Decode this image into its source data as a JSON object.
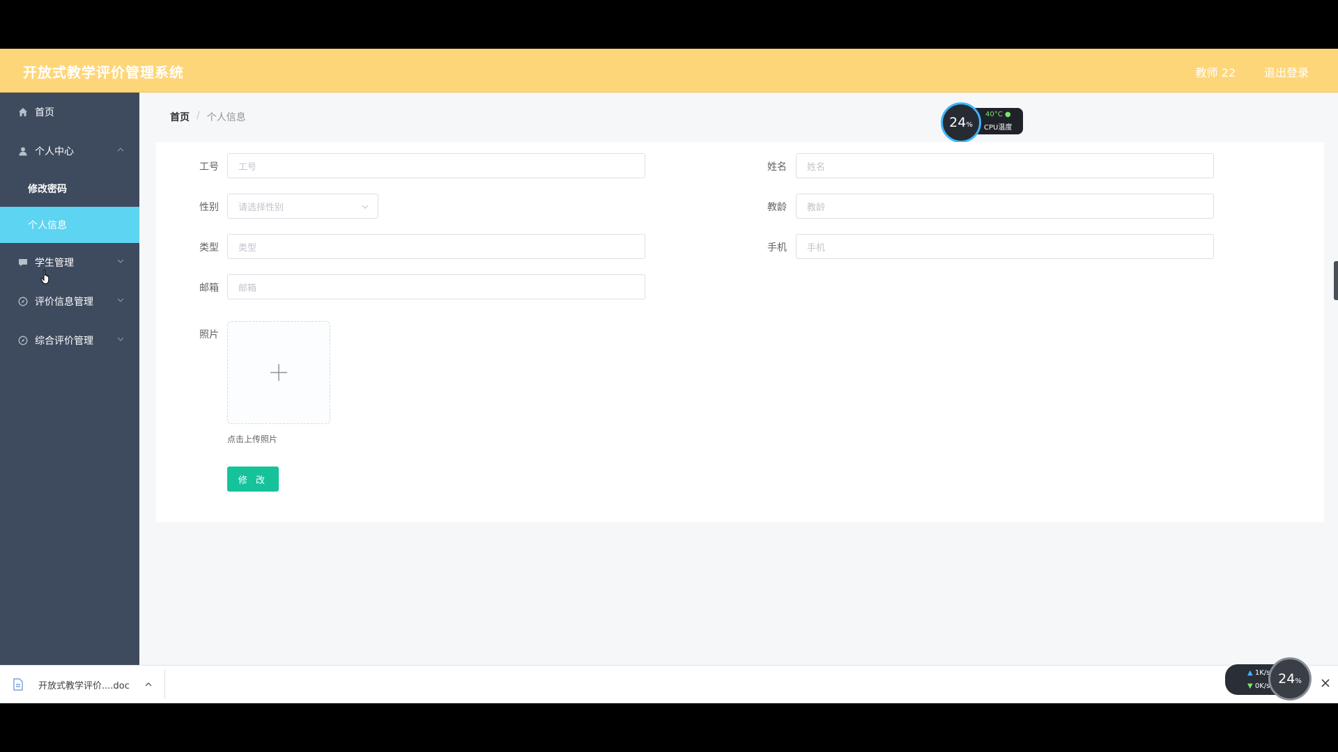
{
  "header": {
    "title": "开放式教学评价管理系统",
    "user": "教师 22",
    "logout": "退出登录"
  },
  "sidebar": {
    "items": [
      {
        "label": "首页",
        "icon": "home-icon"
      },
      {
        "label": "个人中心",
        "icon": "user-icon",
        "expanded": true,
        "children": [
          {
            "label": "修改密码"
          },
          {
            "label": "个人信息",
            "active": true
          }
        ]
      },
      {
        "label": "学生管理",
        "icon": "chat-icon"
      },
      {
        "label": "评价信息管理",
        "icon": "compass-icon"
      },
      {
        "label": "综合评价管理",
        "icon": "compass-icon"
      }
    ]
  },
  "breadcrumb": {
    "home": "首页",
    "separator": "/",
    "current": "个人信息"
  },
  "form": {
    "job_no": {
      "label": "工号",
      "placeholder": "工号"
    },
    "name": {
      "label": "姓名",
      "placeholder": "姓名"
    },
    "gender": {
      "label": "性别",
      "placeholder": "请选择性别"
    },
    "teaching_years": {
      "label": "教龄",
      "placeholder": "教龄"
    },
    "type": {
      "label": "类型",
      "placeholder": "类型"
    },
    "phone": {
      "label": "手机",
      "placeholder": "手机"
    },
    "email": {
      "label": "邮箱",
      "placeholder": "邮箱"
    },
    "photo": {
      "label": "照片",
      "tip": "点击上传照片"
    },
    "submit": "修 改"
  },
  "cpu_widget": {
    "percent": "24",
    "percent_unit": "%",
    "temperature": "40°C",
    "label": "CPU温度"
  },
  "download_bar": {
    "file_name": "开放式教学评价....doc"
  },
  "net_widget": {
    "up": "1K/s",
    "down": "0K/s",
    "percent": "24",
    "percent_unit": "%"
  },
  "colors": {
    "header": "#fed67a",
    "sidebar": "#3e4a5e",
    "active_menu": "#5dd4f1",
    "primary_button": "#16c29a"
  }
}
